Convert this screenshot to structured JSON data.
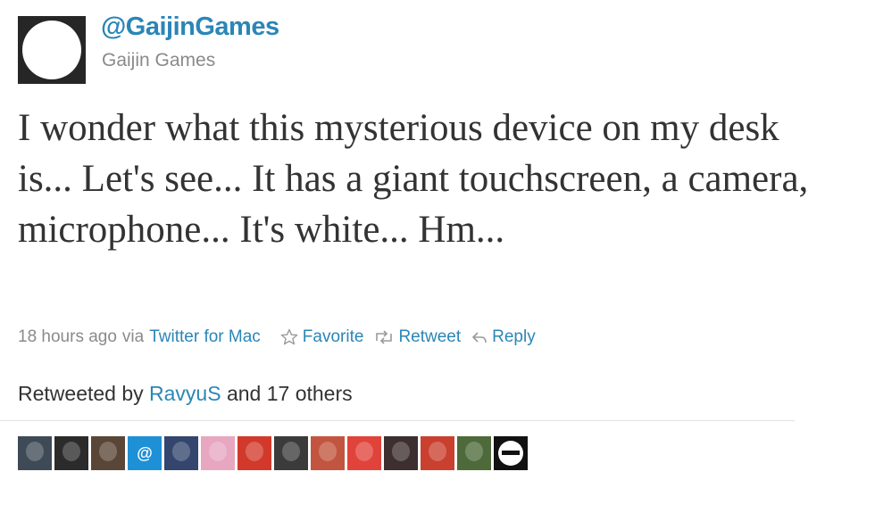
{
  "tweet": {
    "handle": "@GaijinGames",
    "display_name": "Gaijin Games",
    "text": "I wonder what this mysterious device on my desk is... Let's see... It has a giant touchscreen, a camera, microphone... It's white... Hm..."
  },
  "meta": {
    "time": "18 hours ago",
    "via_prefix": "via",
    "source": "Twitter for Mac",
    "favorite_label": "Favorite",
    "retweet_label": "Retweet",
    "reply_label": "Reply"
  },
  "retweets": {
    "prefix": "Retweeted by",
    "user": "RavyuS",
    "suffix": "and 17 others"
  },
  "colors": {
    "link": "#2a86b6",
    "muted": "#8a8a8a",
    "text": "#333333"
  },
  "retweeters": [
    {
      "icon": "retweeter-avatar",
      "color": "#3f4a57"
    },
    {
      "icon": "retweeter-avatar",
      "color": "#2b2b2b"
    },
    {
      "icon": "retweeter-avatar",
      "color": "#5a4636"
    },
    {
      "icon": "at-sign-avatar",
      "color": "#1e90d6",
      "glyph": "@"
    },
    {
      "icon": "retweeter-avatar",
      "color": "#34466e"
    },
    {
      "icon": "retweeter-avatar",
      "color": "#e7a7c0"
    },
    {
      "icon": "retweeter-avatar",
      "color": "#d2392b"
    },
    {
      "icon": "retweeter-avatar",
      "color": "#3b3b3b"
    },
    {
      "icon": "retweeter-avatar",
      "color": "#c2553f"
    },
    {
      "icon": "retweeter-avatar",
      "color": "#e0433a"
    },
    {
      "icon": "retweeter-avatar",
      "color": "#3d2f2f"
    },
    {
      "icon": "retweeter-avatar",
      "color": "#c9402f"
    },
    {
      "icon": "retweeter-avatar",
      "color": "#4e6a3a"
    },
    {
      "icon": "glasses-avatar",
      "color": "#111111"
    }
  ]
}
